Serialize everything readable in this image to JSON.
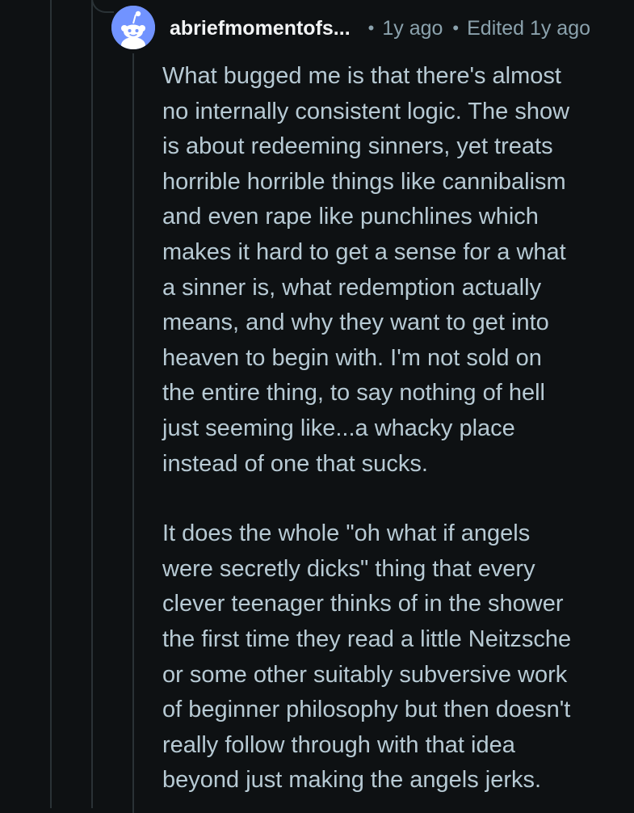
{
  "comment": {
    "username": "abriefmomentofs...",
    "separator": "•",
    "timestamp": "1y ago",
    "edited": "Edited 1y ago",
    "avatar_icon": "reddit-snoo-avatar-icon",
    "avatar_color": "#7193ff",
    "paragraphs": [
      "What bugged me is that there's almost\nno internally consistent logic. The show\nis about redeeming sinners, yet treats\nhorrible horrible things like cannibalism\nand even rape like punchlines which\nmakes it hard to get a sense for a what\na sinner is, what redemption actually\nmeans, and why they want to get into\nheaven to begin with. I'm not sold on\nthe entire thing, to say nothing of hell\njust seeming like...a whacky place\ninstead of one that sucks.",
      "It does the whole \"oh what if angels\nwere secretly dicks\" thing that every\nclever teenager thinks of in the shower\nthe first time they read a little Neitzsche\nor some other suitably subversive work\nof beginner philosophy but then doesn't\nreally follow through with that idea\nbeyond just making the angels jerks."
    ]
  },
  "theme": {
    "background": "#0e1113",
    "thread_line": "#2a3236",
    "body_text": "#b7cad4",
    "username_text": "#f2f4f5",
    "meta_text": "#8ba2ad"
  }
}
